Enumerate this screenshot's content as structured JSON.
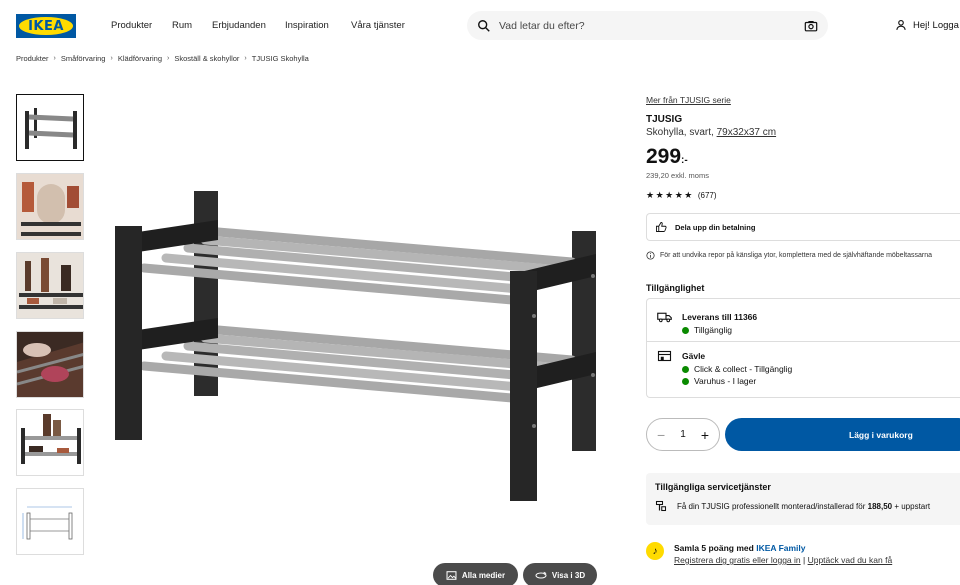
{
  "header": {
    "logo_text": "IKEA",
    "nav": [
      "Produkter",
      "Rum",
      "Erbjudanden",
      "Inspiration",
      "Våra tjänster"
    ],
    "search_placeholder": "Vad letar du efter?",
    "login_label": "Hej! Logga"
  },
  "breadcrumb": [
    "Produkter",
    "Småförvaring",
    "Klädförvaring",
    "Skoställ & skohyllor",
    "TJUSIG Skohylla"
  ],
  "gallery": {
    "all_media_label": "Alla medier",
    "view_3d_label": "Visa i 3D"
  },
  "product": {
    "series_link": "Mer från TJUSIG serie",
    "name": "TJUSIG",
    "description": "Skohylla, svart,",
    "dimensions": "79x32x37 cm",
    "price_main": "299",
    "price_suffix": ":-",
    "price_ex_vat": "239,20 exkl. moms",
    "rating_stars": "★★★★★",
    "rating_count": "(677)",
    "installment_label": "Dela upp din betalning",
    "info_text": "För att undvika repor på känsliga ytor, komplettera med de självhäftande möbeltassarna"
  },
  "availability": {
    "title": "Tillgänglighet",
    "delivery_title": "Leverans till 11366",
    "delivery_status": "Tillgänglig",
    "store_title": "Gävle",
    "store_line1": "Click & collect - Tillgänglig",
    "store_line2": "Varuhus - I lager",
    "status_color": "#0a8a00"
  },
  "purchase": {
    "quantity": "1",
    "add_to_cart_label": "Lägg i varukorg",
    "accent_color": "#0058a3"
  },
  "services": {
    "title": "Tillgängliga servicetjänster",
    "text_prefix": "Få din TJUSIG professionellt monterad/installerad för",
    "text_price": "188,50",
    "text_suffix": "+ uppstart"
  },
  "family": {
    "line1_prefix": "Samla 5 poäng med",
    "line1_link": "IKEA Family",
    "link_register": "Registrera dig gratis eller logga in",
    "divider": "|",
    "link_discover": "Upptäck vad du kan få"
  }
}
